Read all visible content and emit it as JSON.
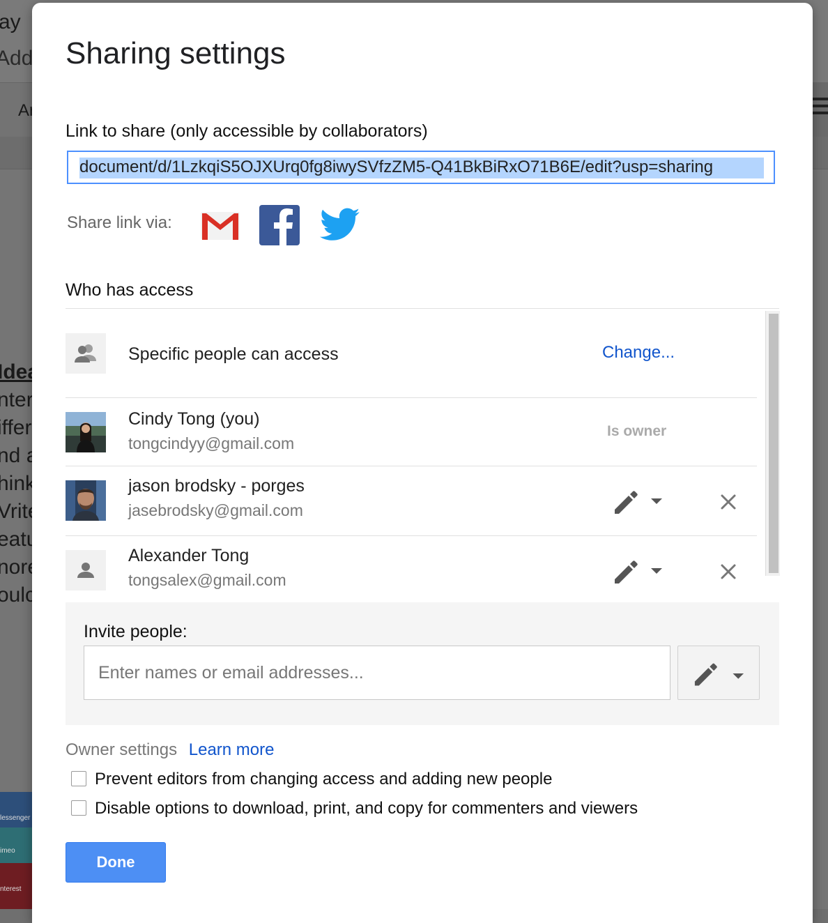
{
  "background": {
    "title_fragment": "ay",
    "menu_fragment": "Add-",
    "toolbar_fragment": "Ar",
    "doc_lines": [
      "Idea",
      "nterv",
      "iffer",
      "nd a",
      "hink",
      "Vrite",
      "eatu",
      "nore",
      "oulc"
    ],
    "strip_labels": [
      "lessenger",
      "imeo",
      "nterest"
    ]
  },
  "dialog": {
    "title": "Sharing settings",
    "link_label": "Link to share (only accessible by collaborators)",
    "link_value": "document/d/1LzkqiS5OJXUrq0fg8iwySVfzZM5-Q41BkBiRxO71B6E/edit?usp=sharing",
    "share_via_label": "Share link via:",
    "share_icons": [
      "gmail-icon",
      "facebook-icon",
      "twitter-icon"
    ],
    "who_has_access_label": "Who has access",
    "access_mode": {
      "label": "Specific people can access",
      "change_label": "Change..."
    },
    "people": [
      {
        "name": "Cindy Tong (you)",
        "email": "tongcindyy@gmail.com",
        "role": "Is owner",
        "avatar": "photo"
      },
      {
        "name": "jason brodsky - porges",
        "email": "jasebrodsky@gmail.com",
        "permission": "edit",
        "avatar": "photo"
      },
      {
        "name": "Alexander Tong",
        "email": "tongsalex@gmail.com",
        "permission": "edit",
        "avatar": "person-icon"
      }
    ],
    "invite": {
      "label": "Invite people:",
      "placeholder": "Enter names or email addresses...",
      "permission": "edit"
    },
    "owner_settings": {
      "label": "Owner settings",
      "learn_more": "Learn more",
      "options": [
        {
          "label": "Prevent editors from changing access and adding new people",
          "checked": false
        },
        {
          "label": "Disable options to download, print, and copy for commenters and viewers",
          "checked": false
        }
      ]
    },
    "done_label": "Done"
  },
  "colors": {
    "accent_blue": "#4d8ff4",
    "link_blue": "#1155cc",
    "selection": "#b4d5fe",
    "focus_border": "#4d90fe"
  }
}
